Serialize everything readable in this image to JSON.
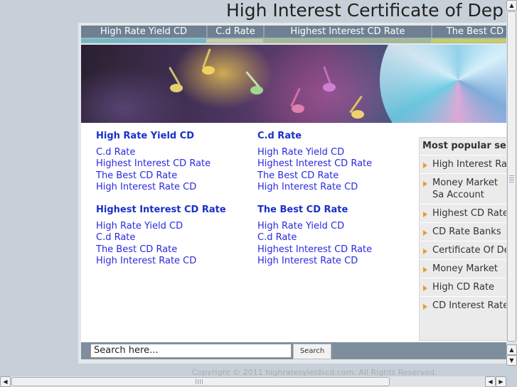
{
  "page": {
    "title": "High Interest Certificate of Dep"
  },
  "nav": {
    "items": [
      {
        "label": "High Rate Yield CD"
      },
      {
        "label": "C.d Rate"
      },
      {
        "label": "Highest Interest CD Rate"
      },
      {
        "label": "The Best CD"
      }
    ]
  },
  "colors": {
    "nav_bg": "#6e8092",
    "link": "#2a2ae0",
    "heading_link": "#1a30c8",
    "bullet": "#e89b2a"
  },
  "groups": [
    {
      "heading": "High Rate Yield CD",
      "links": [
        "C.d Rate",
        "Highest Interest CD Rate",
        "The Best CD Rate",
        "High Interest Rate CD"
      ]
    },
    {
      "heading": "C.d Rate",
      "links": [
        "High Rate Yield CD",
        "Highest Interest CD Rate",
        "The Best CD Rate",
        "High Interest Rate CD"
      ]
    },
    {
      "heading": "Highest Interest CD Rate",
      "links": [
        "High Rate Yield CD",
        "C.d Rate",
        "The Best CD Rate",
        "High Interest Rate CD"
      ]
    },
    {
      "heading": "The Best CD Rate",
      "links": [
        "High Rate Yield CD",
        "C.d Rate",
        "Highest Interest CD Rate",
        "High Interest Rate CD"
      ]
    }
  ],
  "sidebar": {
    "title": "Most popular se",
    "items": [
      "High Interest Rat",
      "Money Market Sa Account",
      "Highest CD Rate",
      "CD Rate Banks",
      "Certificate Of De",
      "Money Market",
      "High CD Rate",
      "CD Interest Rate"
    ]
  },
  "search": {
    "placeholder": "Search here...",
    "button": "Search"
  },
  "footer": {
    "text": "Copyright © 2011 highratesyieldscd.com. All Rights Reserved."
  },
  "icons": {
    "bullet": "triangle-right-icon",
    "up": "arrow-up-icon",
    "down": "arrow-down-icon",
    "left": "arrow-left-icon",
    "right": "arrow-right-icon"
  }
}
